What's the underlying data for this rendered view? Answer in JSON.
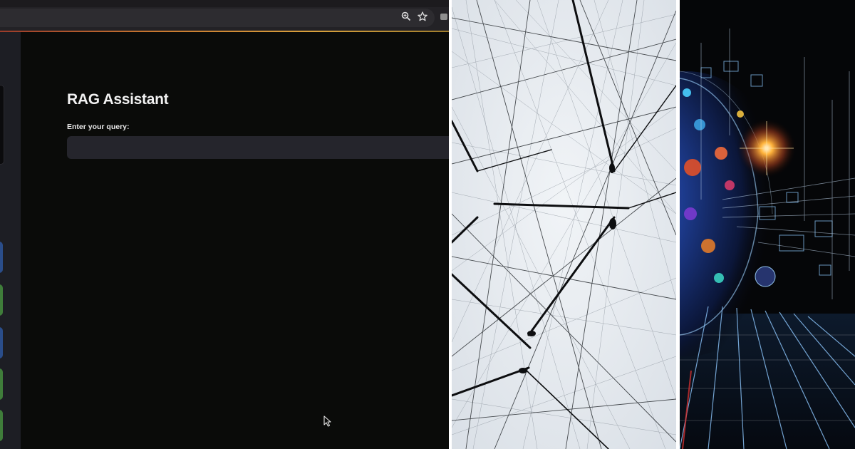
{
  "app": {
    "title": "RAG Assistant",
    "query_label": "Enter your query:",
    "query_value": "",
    "query_placeholder": ""
  },
  "browser": {
    "icons": [
      "zoom-icon",
      "bookmark-star-icon"
    ]
  },
  "colors": {
    "app_background": "#0a0b09",
    "input_background": "#25252c",
    "sidebar_background": "#1d1e24",
    "accent_orange": "#c8782f",
    "sidebar_blue": "#2a4d8a",
    "sidebar_green": "#3f7d3a"
  },
  "images": [
    {
      "name": "network-lines-photo"
    },
    {
      "name": "futuristic-data-illustration"
    }
  ]
}
